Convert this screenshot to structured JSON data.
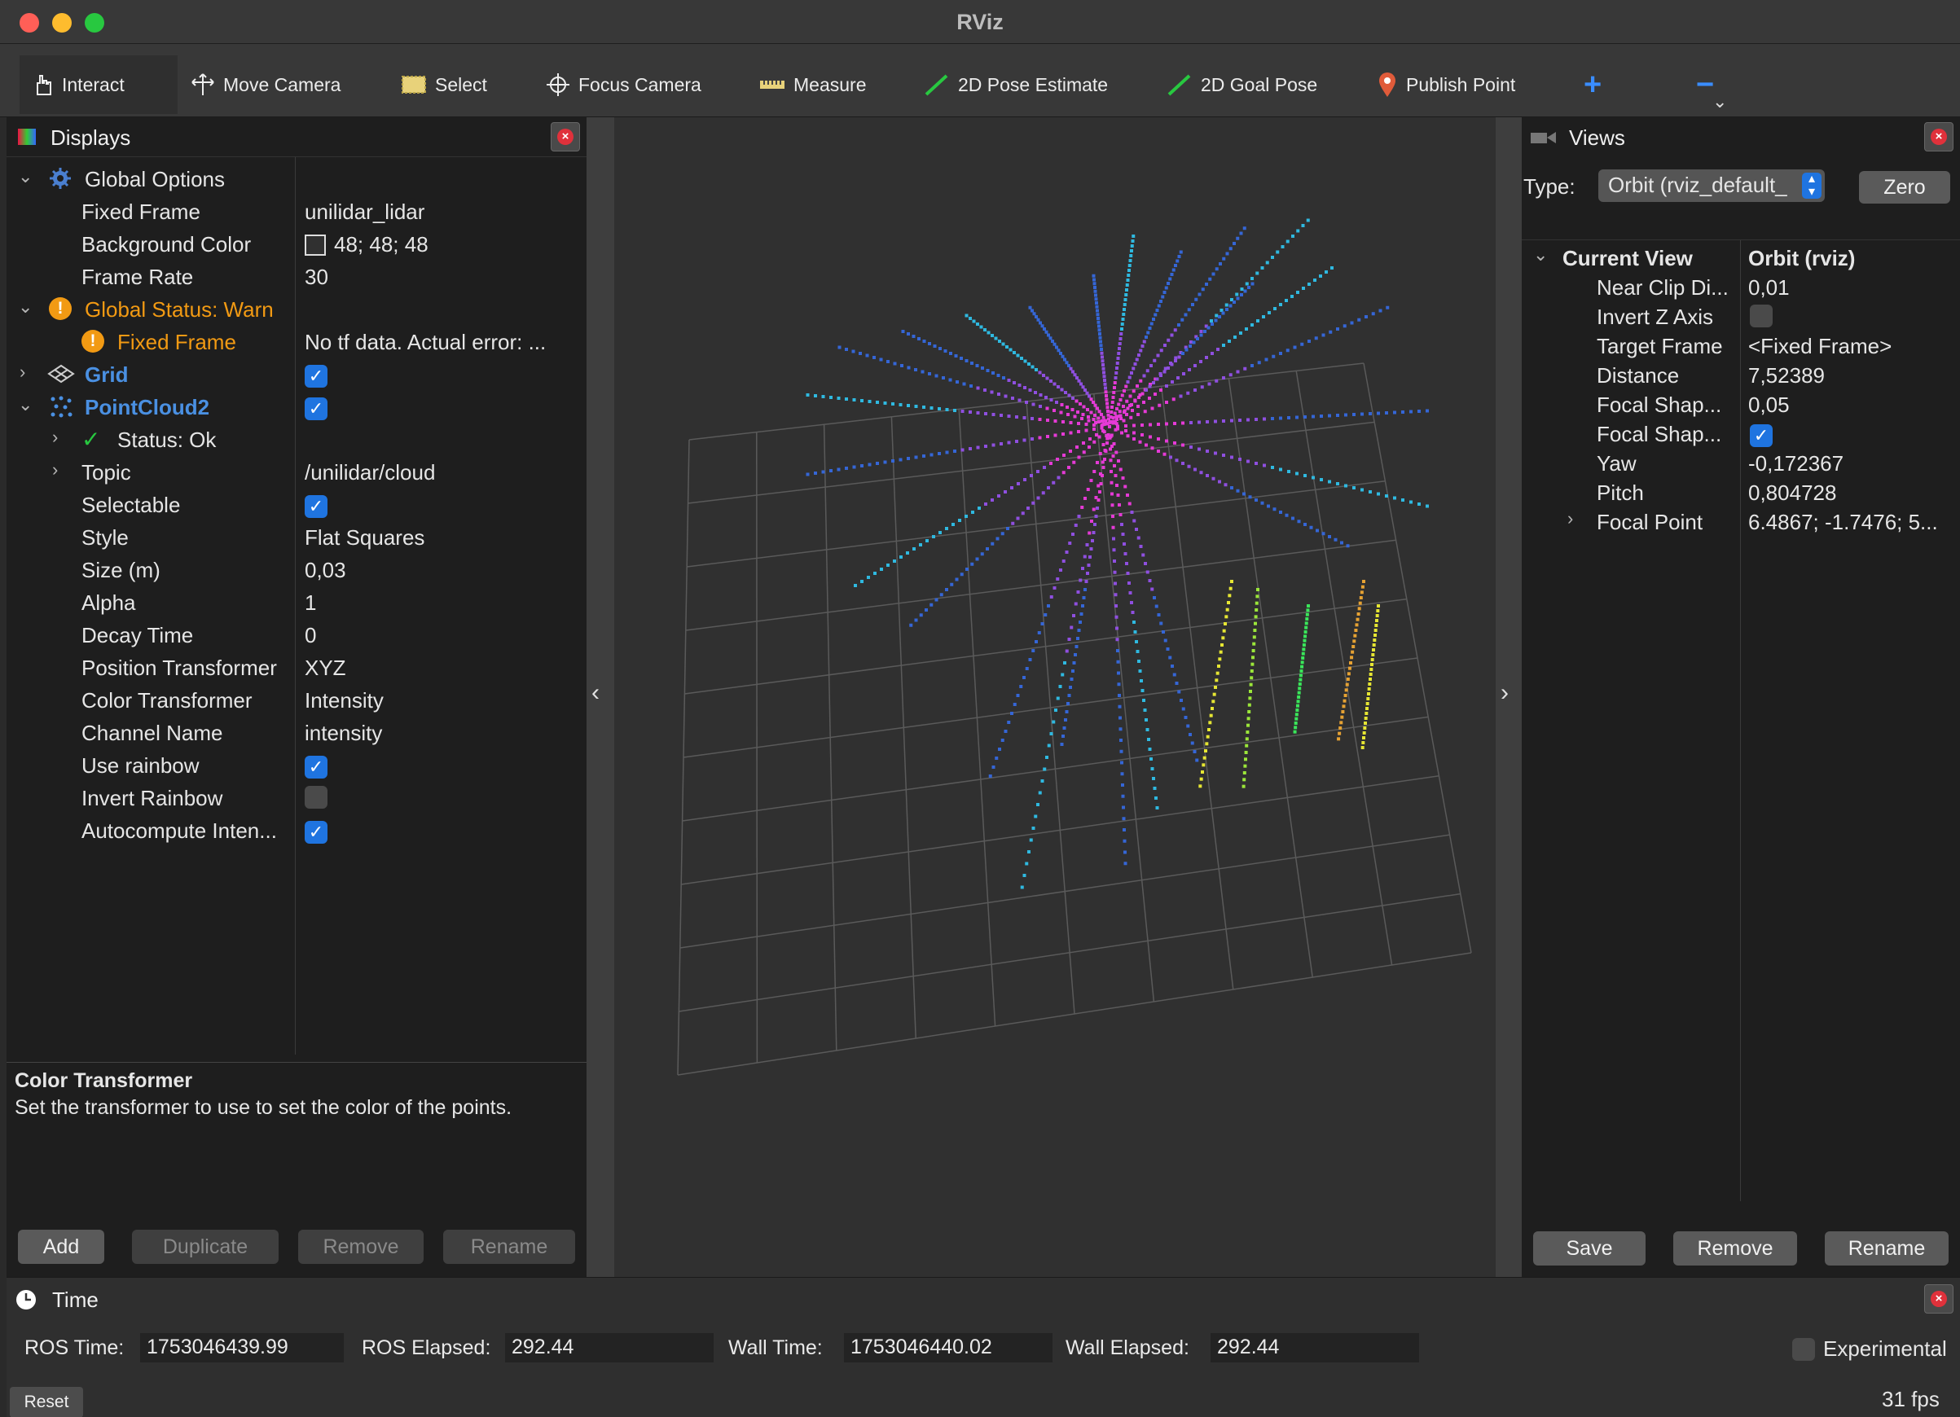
{
  "window": {
    "title": "RViz"
  },
  "toolbar": {
    "tools": [
      {
        "label": "Interact",
        "icon": "hand-pointer-icon"
      },
      {
        "label": "Move Camera",
        "icon": "move-arrows-icon"
      },
      {
        "label": "Select",
        "icon": "select-box-icon"
      },
      {
        "label": "Focus Camera",
        "icon": "crosshair-icon"
      },
      {
        "label": "Measure",
        "icon": "ruler-icon"
      },
      {
        "label": "2D Pose Estimate",
        "icon": "green-arrow-icon"
      },
      {
        "label": "2D Goal Pose",
        "icon": "green-arrow-icon"
      },
      {
        "label": "Publish Point",
        "icon": "map-pin-icon"
      }
    ],
    "add_tool": "+",
    "remove_tool": "−"
  },
  "displays": {
    "title": "Displays",
    "rows": {
      "global_options": "Global Options",
      "fixed_frame": {
        "label": "Fixed Frame",
        "value": "unilidar_lidar"
      },
      "background_color": {
        "label": "Background Color",
        "value": "48; 48; 48"
      },
      "frame_rate": {
        "label": "Frame Rate",
        "value": "30"
      },
      "global_status": "Global Status: Warn",
      "fixed_frame_status": {
        "label": "Fixed Frame",
        "value": "No tf data.  Actual error: ..."
      },
      "grid": {
        "label": "Grid",
        "checked": true
      },
      "pointcloud2": {
        "label": "PointCloud2",
        "checked": true
      },
      "status_ok": "Status: Ok",
      "topic": {
        "label": "Topic",
        "value": "/unilidar/cloud"
      },
      "selectable": {
        "label": "Selectable",
        "checked": true
      },
      "style": {
        "label": "Style",
        "value": "Flat Squares"
      },
      "size": {
        "label": "Size (m)",
        "value": "0,03"
      },
      "alpha": {
        "label": "Alpha",
        "value": "1"
      },
      "decay_time": {
        "label": "Decay Time",
        "value": "0"
      },
      "position_transformer": {
        "label": "Position Transformer",
        "value": "XYZ"
      },
      "color_transformer": {
        "label": "Color Transformer",
        "value": "Intensity"
      },
      "channel_name": {
        "label": "Channel Name",
        "value": "intensity"
      },
      "use_rainbow": {
        "label": "Use rainbow",
        "checked": true
      },
      "invert_rainbow": {
        "label": "Invert Rainbow",
        "checked": false
      },
      "autocompute": {
        "label": "Autocompute Inten...",
        "checked": true
      }
    },
    "description": {
      "heading": "Color Transformer",
      "body": "Set the transformer to use to set the color of the points."
    },
    "buttons": {
      "add": "Add",
      "duplicate": "Duplicate",
      "remove": "Remove",
      "rename": "Rename"
    }
  },
  "views": {
    "title": "Views",
    "type_label": "Type:",
    "type_value": "Orbit (rviz_default_",
    "zero_button": "Zero",
    "current_view": {
      "label": "Current View",
      "value": "Orbit (rviz)"
    },
    "rows": [
      {
        "label": "Near Clip Di...",
        "value": "0,01"
      },
      {
        "label": "Invert Z Axis",
        "value": ""
      },
      {
        "label": "Target Frame",
        "value": "<Fixed Frame>"
      },
      {
        "label": "Distance",
        "value": "7,52389"
      },
      {
        "label": "Focal Shap...",
        "value": "0,05"
      },
      {
        "label": "Focal Shap...",
        "value": ""
      },
      {
        "label": "Yaw",
        "value": "-0,172367"
      },
      {
        "label": "Pitch",
        "value": "0,804728"
      },
      {
        "label": "Focal Point",
        "value": "6.4867; -1.7476; 5..."
      }
    ],
    "buttons": {
      "save": "Save",
      "remove": "Remove",
      "rename": "Rename"
    }
  },
  "time": {
    "title": "Time",
    "ros_time_label": "ROS Time:",
    "ros_time": "1753046439.99",
    "ros_elapsed_label": "ROS Elapsed:",
    "ros_elapsed": "292.44",
    "wall_time_label": "Wall Time:",
    "wall_time": "1753046440.02",
    "wall_elapsed_label": "Wall Elapsed:",
    "wall_elapsed": "292.44",
    "experimental": "Experimental",
    "reset": "Reset",
    "fps": "31 fps"
  },
  "colors": {
    "background": "#303030",
    "accent": "#1f74e0",
    "warn": "#f29a13",
    "link_blue": "#4a90e2"
  }
}
